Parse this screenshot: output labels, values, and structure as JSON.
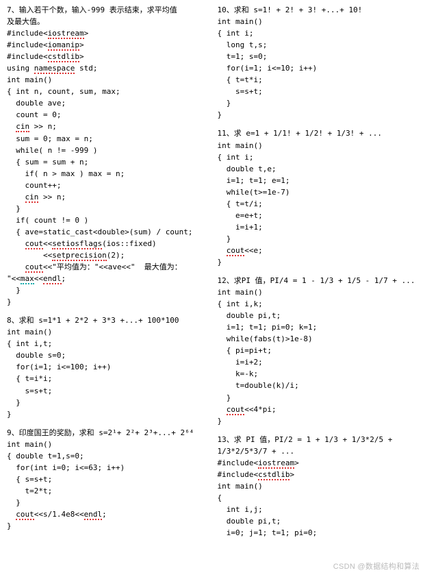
{
  "left": {
    "p7": {
      "title_a": "7、输入若干个数，输入-999 表示结束，求平均值",
      "title_b": "及最大值。",
      "l1a": "#include<",
      "l1s": "iostream",
      "l1c": ">",
      "l2a": "#include<",
      "l2s": "iomanip",
      "l2c": ">",
      "l3a": "#include<",
      "l3s": "cstdlib",
      "l3c": ">",
      "l4a": "using ",
      "l4s": "namespace",
      "l4c": " std;",
      "l5": "int main()",
      "l6": "{ int n, count, sum, max;",
      "l7": "  double ave;",
      "l8": "  count = 0;",
      "l9a": "  ",
      "l9s": "cin",
      "l9c": " >> n;",
      "l10": "  sum = 0; max = n;",
      "l11": "  while( n != -999 )",
      "l12": "  { sum = sum + n;",
      "l13": "    if( n > max ) max = n;",
      "l14": "    count++;",
      "l15a": "    ",
      "l15s": "cin",
      "l15c": " >> n;",
      "l16": "  }",
      "l17": "  if( count != 0 )",
      "l18": "  { ave=static_cast<double>(sum) / count;",
      "l19a": "    ",
      "l19s": "cout",
      "l19b": "<<",
      "l19c": "setiosflags",
      "l19d": "(ios::fixed)",
      "l20a": "        <<",
      "l20s": "setprecision",
      "l20c": "(2);",
      "l21a": "    ",
      "l21s": "cout",
      "l21c": "<<\"平均值为：\"<<ave<<\"  最大值为：",
      "l22a": "\"<<",
      "l22s": "max",
      "l22c": "<<",
      "l22d": "endl",
      "l22e": ";",
      "l23": "  }",
      "l24": "}"
    },
    "p8": {
      "title": "8、求和 s=1*1 + 2*2 + 3*3 +...+ 100*100",
      "l1": "int main()",
      "l2": "{ int i,t;",
      "l3": "  double s=0;",
      "l4": "  for(i=1; i<=100; i++)",
      "l5": "  { t=i*i;",
      "l6": "    s=s+t;",
      "l7": "  }",
      "l8": "}"
    },
    "p9": {
      "title_a": "9、印度国王的奖励，求和 s=2",
      "title_b": "¹",
      "title_c": "+ 2",
      "title_d": "²",
      "title_e": "+ 2",
      "title_f": "³",
      "title_g": "+...+ 2",
      "title_h": "⁶⁴",
      "l1": "int main()",
      "l2": "{ double t=1,s=0;",
      "l3": "  for(int i=0; i<=63; i++)",
      "l4": "  { s=s+t;",
      "l5": "    t=2*t;",
      "l6": "  }",
      "l7a": "  ",
      "l7s": "cout",
      "l7c": "<<s/1.4e8<<",
      "l7d": "endl",
      "l7e": ";",
      "l8": "}"
    }
  },
  "right": {
    "p10": {
      "title": "10、求和 s=1! + 2! + 3! +...+ 10!",
      "l1": "int main()",
      "l2": "{ int i;",
      "l3": "  long t,s;",
      "l4": "  t=1; s=0;",
      "l5": "  for(i=1; i<=10; i++)",
      "l6": "  { t=t*i;",
      "l7": "    s=s+t;",
      "l8": "  }",
      "l9": "}"
    },
    "p11": {
      "title": "11、求 e=1 + 1/1! + 1/2! + 1/3! + ...",
      "l1": "int main()",
      "l2": "{ int i;",
      "l3": "  double t,e;",
      "l4": "  i=1; t=1; e=1;",
      "l5": "  while(t>=1e-7)",
      "l6": "  { t=t/i;",
      "l7": "    e=e+t;",
      "l8": "    i=i+1;",
      "l9": "  }",
      "l10a": "  ",
      "l10s": "cout",
      "l10c": "<<e;",
      "l11": "}"
    },
    "p12": {
      "title": "12、求PI 值，PI/4 = 1 - 1/3 + 1/5 - 1/7 + ...",
      "l1": "int main()",
      "l2": "{ int i,k;",
      "l3": "  double pi,t;",
      "l4": "  i=1; t=1; pi=0; k=1;",
      "l5": "  while(fabs(t)>1e-8)",
      "l6": "  { pi=pi+t;",
      "l7": "    i=i+2;",
      "l8": "    k=-k;",
      "l9": "    t=double(k)/i;",
      "l10": "  }",
      "l11a": "  ",
      "l11s": "cout",
      "l11c": "<<4*pi;",
      "l12": "}"
    },
    "p13": {
      "title_a": "13、求 PI 值，PI/2 = 1 + 1/3 + 1/3*2/5 +",
      "title_b": "1/3*2/5*3/7 + ...",
      "l1a": "#include<",
      "l1s": "iostream",
      "l1c": ">",
      "l2a": "#include<",
      "l2s": "cstdlib",
      "l2c": ">",
      "l3": "int main()",
      "l4": "{",
      "l5": "  int i,j;",
      "l6": "  double pi,t;",
      "l7": "  i=0; j=1; t=1; pi=0;"
    }
  },
  "watermark": "CSDN @数据结构和算法"
}
